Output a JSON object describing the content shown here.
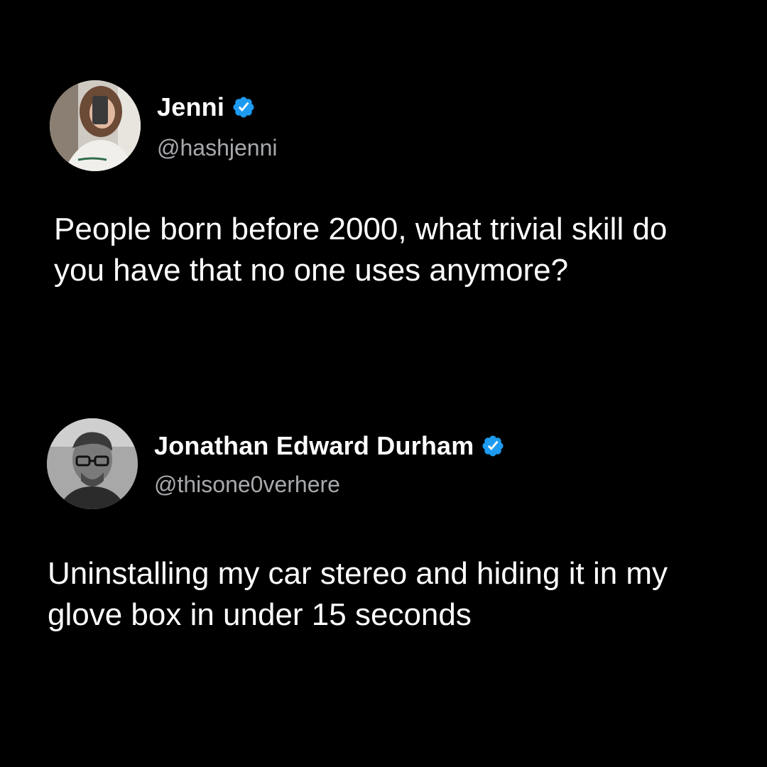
{
  "posts": [
    {
      "display_name": "Jenni",
      "verified": true,
      "handle": "@hashjenni",
      "avatar_icon": "user-photo-avatar",
      "text": "People born before 2000, what trivial skill do you have that no one uses anymore?"
    },
    {
      "display_name": "Jonathan Edward Durham",
      "verified": true,
      "handle": "@thisone0verhere",
      "avatar_icon": "user-photo-avatar",
      "text": "Uninstalling my car stereo and hiding it in my glove box in under 15 seconds"
    }
  ],
  "colors": {
    "background": "#000000",
    "text": "#ffffff",
    "handle": "#a7a9ac",
    "verified_badge": "#1d9bf0"
  }
}
